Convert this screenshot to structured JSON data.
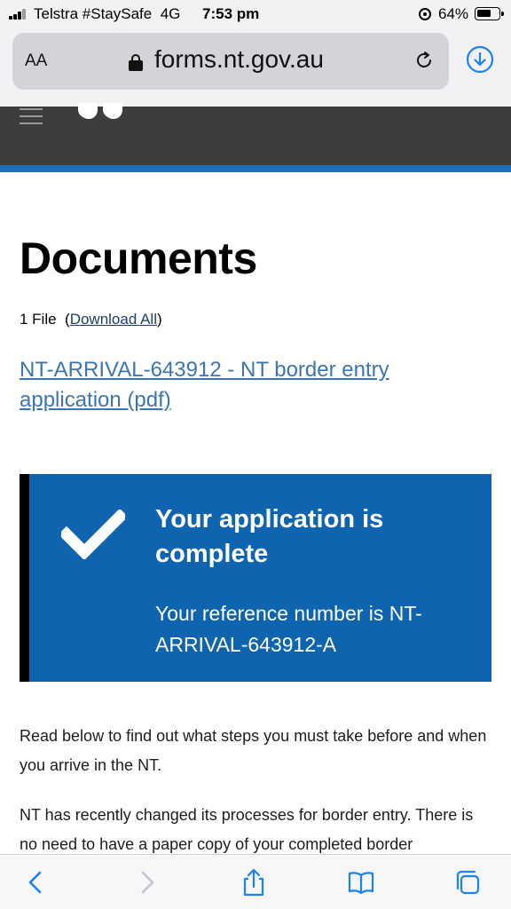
{
  "status_bar": {
    "carrier": "Telstra #StaySafe",
    "network": "4G",
    "time": "7:53 pm",
    "battery_percent": "64%",
    "battery_level": 0.64
  },
  "browser": {
    "text_size_label": "AA",
    "url": "forms.nt.gov.au"
  },
  "page": {
    "title": "Documents",
    "file_count": "1 File",
    "download_all_label": "Download All",
    "document_link": "NT-ARRIVAL-643912 - NT border entry application (pdf)",
    "success": {
      "title": "Your application is complete",
      "reference": "Your reference number is NT-ARRIVAL-643912-A"
    },
    "paragraphs": [
      "Read below to find out what steps you must take before and when you arrive in the NT.",
      "NT has recently changed its processes for border entry. There is no need to have a paper copy of your completed border"
    ]
  },
  "colors": {
    "accent_blue": "#0f64b0",
    "link_blue": "#3a76b4",
    "header_dark": "#3d3c3e",
    "ios_blue": "#1a82f7"
  },
  "icons": [
    "signal-icon",
    "orientation-lock-icon",
    "battery-icon",
    "lock-icon",
    "reload-icon",
    "download-icon",
    "menu-icon",
    "logo",
    "check-icon",
    "back-icon",
    "forward-icon",
    "share-icon",
    "bookmarks-icon",
    "tabs-icon"
  ]
}
